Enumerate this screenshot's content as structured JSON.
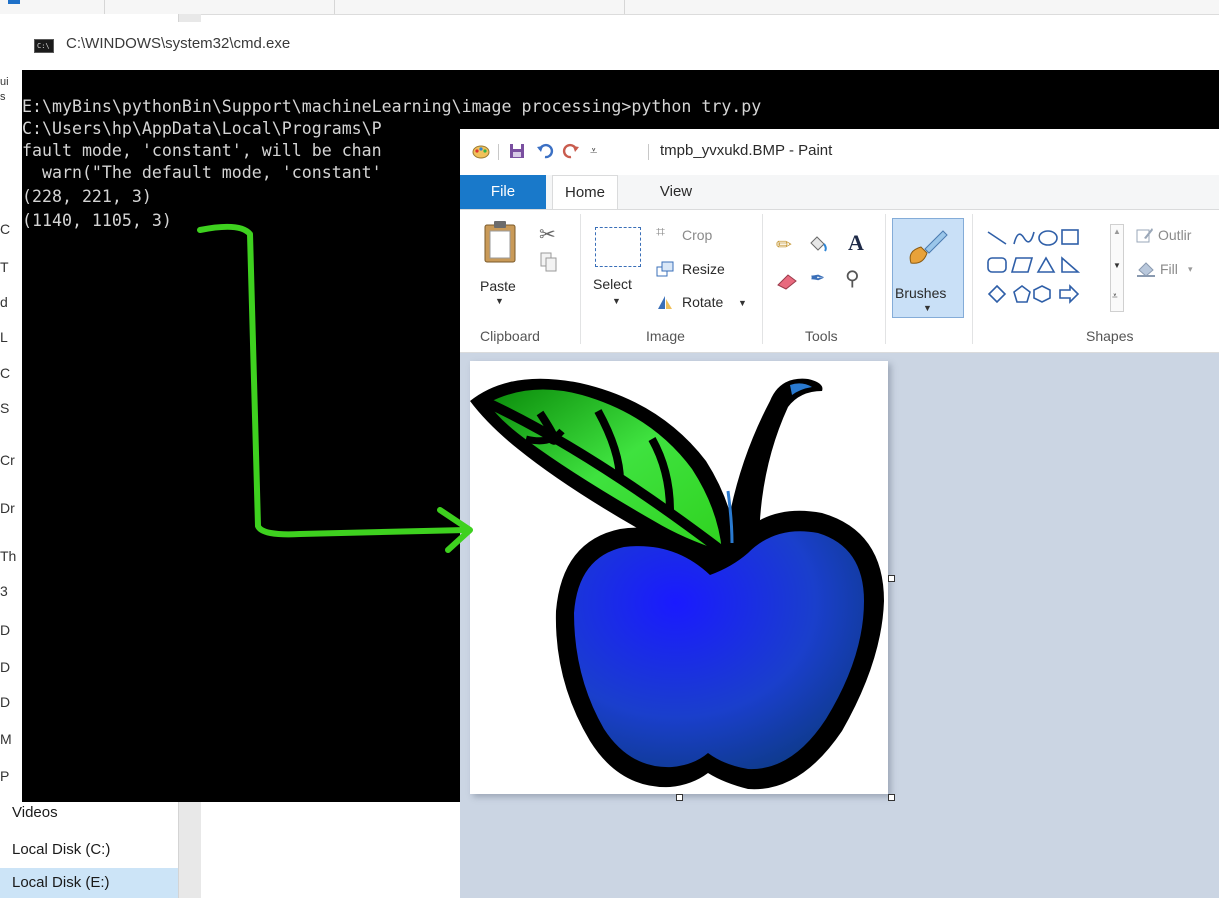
{
  "explorer": {
    "partial_left_chars": [
      "ui",
      "s",
      "C",
      "T",
      "d",
      "L",
      "C",
      "S",
      "Cr",
      "Dr",
      "Th",
      "3",
      "D",
      "D",
      "D",
      "M",
      "P"
    ],
    "nav_items": [
      "Videos",
      "Local Disk (C:)",
      "Local Disk (E:)"
    ],
    "selected_item": "Local Disk (E:)"
  },
  "cmd": {
    "title": "C:\\WINDOWS\\system32\\cmd.exe",
    "icon": "cmd-icon",
    "lines": [
      "E:\\myBins\\pythonBin\\Support\\machineLearning\\image processing>python try.py",
      "C:\\Users\\hp\\AppData\\Local\\Programs\\P",
      "fault mode, 'constant', will be chan",
      "  warn(\"The default mode, 'constant'",
      "(228, 221, 3)",
      "(1140, 1105, 3)"
    ]
  },
  "annotation": {
    "arrow_color": "#3ed11f"
  },
  "paint": {
    "title": "tmpb_yvxukd.BMP - Paint",
    "tabs": {
      "file": "File",
      "home": "Home",
      "view": "View"
    },
    "clipboard": {
      "paste": "Paste",
      "label": "Clipboard"
    },
    "image": {
      "select": "Select",
      "crop": "Crop",
      "resize": "Resize",
      "rotate": "Rotate",
      "label": "Image"
    },
    "tools": {
      "label": "Tools"
    },
    "brushes": {
      "label": "Brushes"
    },
    "shapes": {
      "outline": "Outlir",
      "fill": "Fill",
      "label": "Shapes"
    },
    "colors": {
      "file_tab": "#1979ca",
      "workspace": "#cbd5e3",
      "apple": "#1a3fcc",
      "leaf": "#2fd21f"
    }
  }
}
